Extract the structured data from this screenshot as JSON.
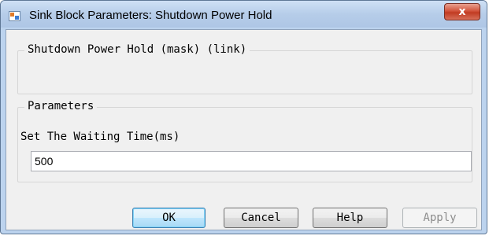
{
  "window": {
    "title": "Sink Block Parameters: Shutdown Power Hold",
    "close_glyph": "x"
  },
  "mask_group": {
    "legend": "Shutdown Power Hold (mask) (link)"
  },
  "parameters_group": {
    "legend": "Parameters",
    "field_label": "Set The Waiting Time(ms)",
    "field_value": "500"
  },
  "buttons": {
    "ok": "OK",
    "cancel": "Cancel",
    "help": "Help",
    "apply": "Apply"
  },
  "colors": {
    "title_bar": "#b9d1ea",
    "close_button": "#c8452e",
    "dialog_body": "#f0f0f0"
  }
}
